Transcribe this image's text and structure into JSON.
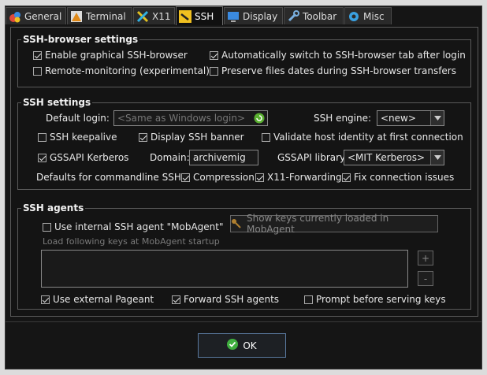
{
  "tabs": [
    {
      "label": "General",
      "icon": "general-icon"
    },
    {
      "label": "Terminal",
      "icon": "terminal-icon"
    },
    {
      "label": "X11",
      "icon": "x11-icon"
    },
    {
      "label": "SSH",
      "icon": "ssh-icon"
    },
    {
      "label": "Display",
      "icon": "display-icon"
    },
    {
      "label": "Toolbar",
      "icon": "toolbar-icon"
    },
    {
      "label": "Misc",
      "icon": "misc-icon"
    }
  ],
  "browser": {
    "title": "SSH-browser settings",
    "enable_graphical": "Enable graphical SSH-browser",
    "auto_switch": "Automatically switch to SSH-browser tab after login",
    "remote_monitoring": "Remote-monitoring (experimental)",
    "preserve_dates": "Preserve files dates during SSH-browser transfers"
  },
  "ssh": {
    "title": "SSH settings",
    "default_login_label": "Default login:",
    "default_login_placeholder": "<Same as Windows login>",
    "engine_label": "SSH engine:",
    "engine_value": "<new>",
    "keepalive": "SSH keepalive",
    "display_banner": "Display SSH banner",
    "validate_host": "Validate host identity at first connection",
    "gssapi": "GSSAPI Kerberos",
    "domain_label": "Domain:",
    "domain_value": "archivemig",
    "gssapi_lib_label": "GSSAPI library:",
    "gssapi_lib_value": "<MIT Kerberos>",
    "defaults_label": "Defaults for commandline SSH:",
    "compression": "Compression",
    "x11_forwarding": "X11-Forwarding",
    "fix_issues": "Fix connection issues"
  },
  "agents": {
    "title": "SSH agents",
    "use_internal": "Use internal SSH agent \"MobAgent\"",
    "show_keys": "Show keys currently loaded in MobAgent",
    "load_keys": "Load following keys at MobAgent startup",
    "add": "+",
    "remove": "-",
    "use_pageant": "Use external Pageant",
    "forward": "Forward SSH agents",
    "prompt": "Prompt before serving keys"
  },
  "ok_label": "OK",
  "colors": {
    "accent": "#5a7aa0",
    "ok_icon": "#3fae3f",
    "refresh_icon": "#5ab030"
  }
}
